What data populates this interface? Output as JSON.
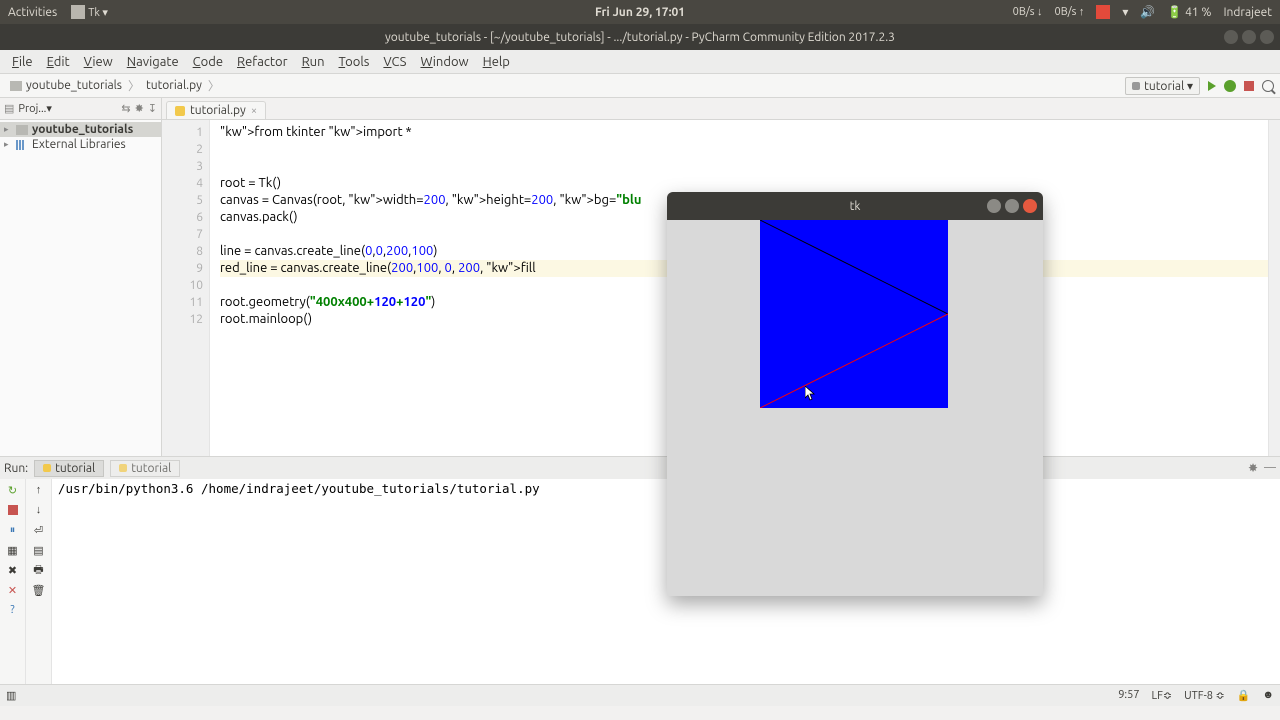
{
  "desktop": {
    "activities": "Activities",
    "app_indicator": "Tk ▾",
    "clock": "Fri Jun 29, 17:01",
    "net_down": "0B/s ↓",
    "net_up": "0B/s ↑",
    "battery": "41 %",
    "user": "Indrajeet"
  },
  "pycharm": {
    "title": "youtube_tutorials - [~/youtube_tutorials] - .../tutorial.py - PyCharm Community Edition 2017.2.3",
    "menus": [
      "File",
      "Edit",
      "View",
      "Navigate",
      "Code",
      "Refactor",
      "Run",
      "Tools",
      "VCS",
      "Window",
      "Help"
    ],
    "breadcrumbs": {
      "root": "youtube_tutorials",
      "file": "tutorial.py"
    },
    "run_config": "tutorial ▾",
    "project_panel": {
      "label": "Proj...▾"
    },
    "tree": {
      "root": "youtube_tutorials",
      "ext": "External Libraries"
    },
    "tab_label": "tutorial.py",
    "code_lines": [
      "from tkinter import *",
      "",
      "",
      "root = Tk()",
      "canvas = Canvas(root, width=200, height=200, bg=\"blu",
      "canvas.pack()",
      "",
      "line = canvas.create_line(0,0,200,100)",
      "red_line = canvas.create_line(200,100, 0, 200, fill=",
      "",
      "root.geometry(\"400x400+120+120\")",
      "root.mainloop()"
    ],
    "run": {
      "label": "Run:",
      "tab_active": "tutorial",
      "tab_inactive": "tutorial",
      "output": "/usr/bin/python3.6 /home/indrajeet/youtube_tutorials/tutorial.py"
    },
    "status": {
      "pos": "9:57",
      "lf": "LF≎",
      "enc": "UTF-8 ≎",
      "lock": "🔒"
    }
  },
  "tk": {
    "title": "tk"
  }
}
